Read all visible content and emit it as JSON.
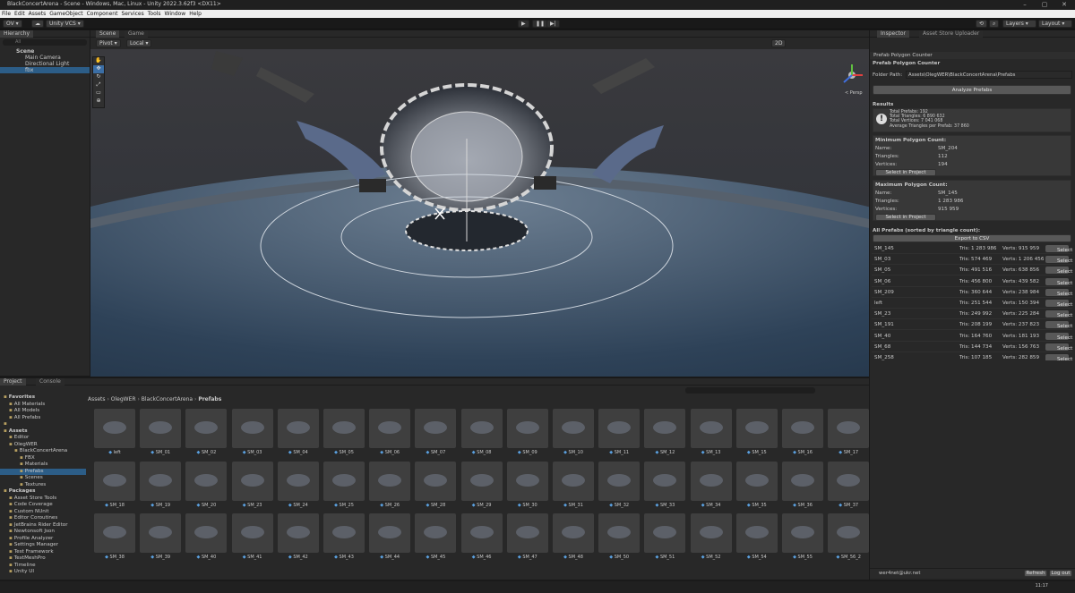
{
  "window": {
    "title": "BlackConcertArena - Scene - Windows, Mac, Linux - Unity 2022.3.62f3 <DX11>"
  },
  "menu": [
    "File",
    "Edit",
    "Assets",
    "GameObject",
    "Component",
    "Services",
    "Tools",
    "Window",
    "Help"
  ],
  "toolbar": {
    "account": "OV",
    "vcs": "Unity VCS",
    "layers": "Layers",
    "layout": "Layout"
  },
  "hierarchy": {
    "tab": "Hierarchy",
    "search": "All",
    "items": [
      "Scene",
      "Main Camera",
      "Directional Light",
      "fbx"
    ]
  },
  "scene": {
    "tabs": [
      "Scene",
      "Game"
    ],
    "pivot": "Pivot",
    "local": "Local",
    "mode2d": "2D",
    "persp": "< Persp"
  },
  "inspector": {
    "tabs": [
      "Inspector",
      "Asset Store Uploader"
    ],
    "window_title": "Prefab Polygon Counter",
    "header": "Prefab Polygon Counter",
    "folder_label": "Folder Path:",
    "folder_value": "Assets\\OlegWER\\BlackConcertArena\\Prefabs",
    "analyze": "Analyze Prefabs",
    "results": "Results",
    "summary": [
      "Total Prefabs: 192",
      "Total Triangles: 6 890 632",
      "Total Vertices: 7 041 068",
      "Average Triangles per Prefab: 37 860"
    ],
    "min": {
      "title": "Minimum Polygon Count:",
      "name": "SM_204",
      "tris": "112",
      "verts": "194"
    },
    "max": {
      "title": "Maximum Polygon Count:",
      "name": "SM_145",
      "tris": "1 283 986",
      "verts": "915 959"
    },
    "labels": {
      "name": "Name:",
      "tris": "Triangles:",
      "verts": "Vertices:",
      "select_in_project": "Select in Project"
    },
    "all_title": "All Prefabs (sorted by triangle count):",
    "export": "Export to CSV",
    "select": "Select",
    "rows": [
      {
        "n": "SM_145",
        "t": "Tris: 1 283 986",
        "v": "Verts: 915 959"
      },
      {
        "n": "SM_03",
        "t": "Tris: 574 469",
        "v": "Verts: 1 206 456"
      },
      {
        "n": "SM_05",
        "t": "Tris: 491 516",
        "v": "Verts: 638 856"
      },
      {
        "n": "SM_06",
        "t": "Tris: 456 800",
        "v": "Verts: 439 582"
      },
      {
        "n": "SM_209",
        "t": "Tris: 360 644",
        "v": "Verts: 238 984"
      },
      {
        "n": "left",
        "t": "Tris: 251 544",
        "v": "Verts: 150 394"
      },
      {
        "n": "SM_23",
        "t": "Tris: 249 992",
        "v": "Verts: 225 284"
      },
      {
        "n": "SM_191",
        "t": "Tris: 208 199",
        "v": "Verts: 237 823"
      },
      {
        "n": "SM_40",
        "t": "Tris: 164 760",
        "v": "Verts: 181 193"
      },
      {
        "n": "SM_68",
        "t": "Tris: 144 734",
        "v": "Verts: 156 763"
      },
      {
        "n": "SM_258",
        "t": "Tris: 107 185",
        "v": "Verts: 282 859"
      }
    ],
    "account": "wer4net@ukr.net",
    "refresh": "Refresh",
    "logout": "Log out"
  },
  "project": {
    "tabs": [
      "Project",
      "Console"
    ],
    "breadcrumb": [
      "Assets",
      "OlegWER",
      "BlackConcertArena",
      "Prefabs"
    ],
    "tree": [
      {
        "label": "Favorites",
        "d": 0
      },
      {
        "label": "All Materials",
        "d": 1
      },
      {
        "label": "All Models",
        "d": 1
      },
      {
        "label": "All Prefabs",
        "d": 1
      },
      {
        "label": "",
        "d": 0
      },
      {
        "label": "Assets",
        "d": 0
      },
      {
        "label": "Editor",
        "d": 1
      },
      {
        "label": "OlegWER",
        "d": 1
      },
      {
        "label": "BlackConcertArena",
        "d": 2
      },
      {
        "label": "FBX",
        "d": 3
      },
      {
        "label": "Materials",
        "d": 3
      },
      {
        "label": "Prefabs",
        "d": 3
      },
      {
        "label": "Scenes",
        "d": 3
      },
      {
        "label": "Textures",
        "d": 3
      },
      {
        "label": "Packages",
        "d": 0
      },
      {
        "label": "Asset Store Tools",
        "d": 1
      },
      {
        "label": "Code Coverage",
        "d": 1
      },
      {
        "label": "Custom NUnit",
        "d": 1
      },
      {
        "label": "Editor Coroutines",
        "d": 1
      },
      {
        "label": "JetBrains Rider Editor",
        "d": 1
      },
      {
        "label": "Newtonsoft Json",
        "d": 1
      },
      {
        "label": "Profile Analyzer",
        "d": 1
      },
      {
        "label": "Settings Manager",
        "d": 1
      },
      {
        "label": "Test Framework",
        "d": 1
      },
      {
        "label": "TextMeshPro",
        "d": 1
      },
      {
        "label": "Timeline",
        "d": 1
      },
      {
        "label": "Unity UI",
        "d": 1
      }
    ],
    "assets": [
      [
        "left",
        "SM_01",
        "SM_02",
        "SM_03",
        "SM_04",
        "SM_05",
        "SM_06",
        "SM_07",
        "SM_08",
        "SM_09",
        "SM_10",
        "SM_11",
        "SM_12",
        "SM_13",
        "SM_15",
        "SM_16",
        "SM_17"
      ],
      [
        "SM_18",
        "SM_19",
        "SM_20",
        "SM_23",
        "SM_24",
        "SM_25",
        "SM_26",
        "SM_28",
        "SM_29",
        "SM_30",
        "SM_31",
        "SM_32",
        "SM_33",
        "SM_34",
        "SM_35",
        "SM_36",
        "SM_37"
      ],
      [
        "SM_38",
        "SM_39",
        "SM_40",
        "SM_41",
        "SM_42",
        "SM_43",
        "SM_44",
        "SM_45",
        "SM_46",
        "SM_47",
        "SM_48",
        "SM_50",
        "SM_51",
        "SM_52",
        "SM_54",
        "SM_55",
        "SM_56_2"
      ]
    ]
  },
  "clock": "11:17"
}
